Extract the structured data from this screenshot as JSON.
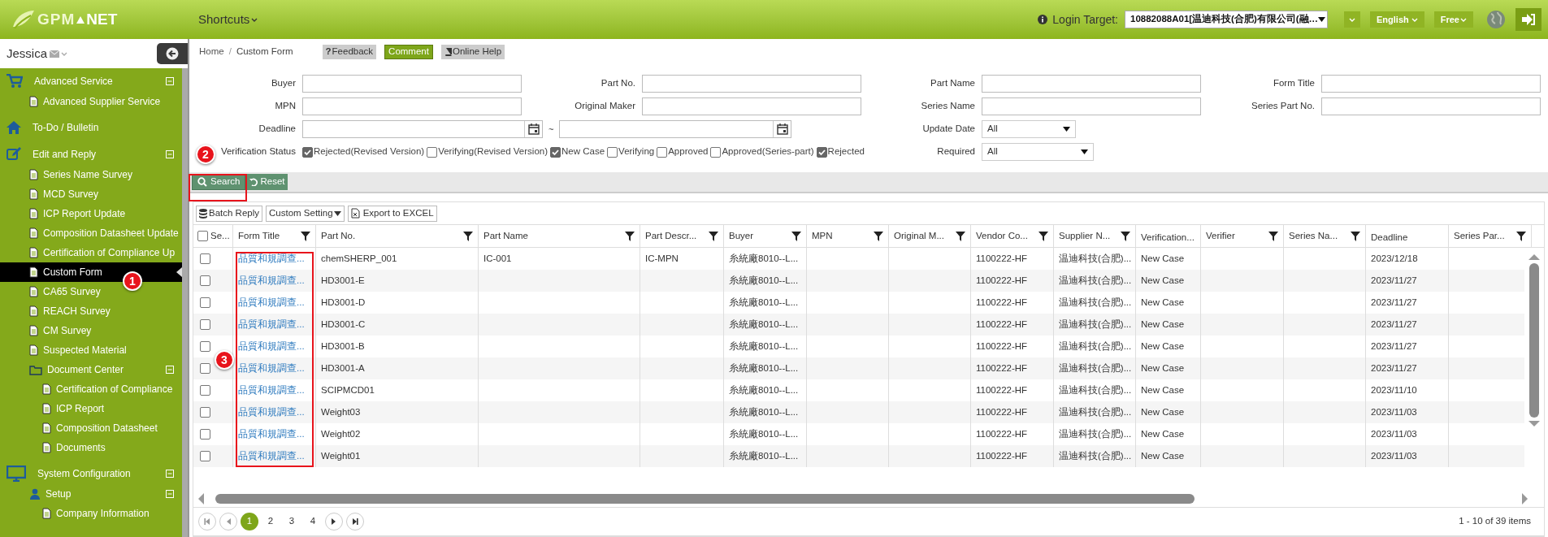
{
  "header": {
    "logo_left": "GPM",
    "logo_right": "NET",
    "shortcuts": "Shortcuts",
    "login_label": "Login Target:",
    "login_value": "10882088A01[温迪科技(合肥)有限公司(融…",
    "language": "English",
    "plan": "Free"
  },
  "sidebar": {
    "user": "Jessica",
    "items": [
      {
        "label": "Advanced Service",
        "kind": "cart",
        "expanded": true,
        "selected": false,
        "children": [
          {
            "label": "Advanced Supplier Service",
            "kind": "doc",
            "selected": false
          }
        ]
      },
      {
        "label": "To-Do / Bulletin",
        "kind": "home",
        "selected": false
      },
      {
        "label": "Edit and Reply",
        "kind": "edit",
        "expanded": true,
        "selected": false,
        "children": [
          {
            "label": "Series Name Survey",
            "kind": "doc",
            "selected": false
          },
          {
            "label": "MCD Survey",
            "kind": "doc",
            "selected": false
          },
          {
            "label": "ICP Report Update",
            "kind": "doc",
            "selected": false
          },
          {
            "label": "Composition Datasheet Update",
            "kind": "doc",
            "selected": false
          },
          {
            "label": "Certification of Compliance Up",
            "kind": "doc",
            "selected": false
          },
          {
            "label": "Custom Form",
            "kind": "doc",
            "selected": true
          },
          {
            "label": "CA65 Survey",
            "kind": "doc",
            "selected": false
          },
          {
            "label": "REACH Survey",
            "kind": "doc",
            "selected": false
          },
          {
            "label": "CM Survey",
            "kind": "doc",
            "selected": false
          },
          {
            "label": "Suspected Material",
            "kind": "doc",
            "selected": false
          },
          {
            "label": "Document Center",
            "kind": "folder",
            "expanded": true,
            "selected": false,
            "children": [
              {
                "label": "Certification of Compliance",
                "kind": "doc",
                "selected": false
              },
              {
                "label": "ICP Report",
                "kind": "doc",
                "selected": false
              },
              {
                "label": "Composition Datasheet",
                "kind": "doc",
                "selected": false
              },
              {
                "label": "Documents",
                "kind": "doc",
                "selected": false
              }
            ]
          }
        ]
      },
      {
        "label": "System Configuration",
        "kind": "monitor",
        "expanded": true,
        "selected": false,
        "children": [
          {
            "label": "Setup",
            "kind": "user",
            "expanded": true,
            "selected": false,
            "children": [
              {
                "label": "Company Information",
                "kind": "doc",
                "selected": false
              }
            ]
          }
        ]
      }
    ]
  },
  "breadcrumb": {
    "items": [
      "Home",
      "Custom Form"
    ],
    "separator": "/"
  },
  "top_buttons": [
    {
      "label": "Feedback",
      "mark": "?",
      "kind": "feedback"
    },
    {
      "label": "Comment",
      "kind": "comment"
    },
    {
      "label": "Online Help",
      "kind": "help"
    }
  ],
  "filters": {
    "buyer": "Buyer",
    "part_no": "Part No.",
    "part_name": "Part Name",
    "form_title": "Form Title",
    "mpn": "MPN",
    "original_maker": "Original Maker",
    "series_name": "Series Name",
    "series_part_no": "Series Part No.",
    "deadline": "Deadline",
    "range_sep": "~",
    "update_date": {
      "label": "Update Date",
      "value": "All"
    },
    "verification_label": "Verification Status",
    "verification": [
      {
        "label": "Rejected(Revised Version)",
        "checked": true
      },
      {
        "label": "Verifying(Revised Version)",
        "checked": false
      },
      {
        "label": "New Case",
        "checked": true
      },
      {
        "label": "Verifying",
        "checked": false
      },
      {
        "label": "Approved",
        "checked": false
      },
      {
        "label": "Approved(Series-part)",
        "checked": false
      },
      {
        "label": "Rejected",
        "checked": true
      }
    ],
    "required": {
      "label": "Required",
      "value": "All"
    }
  },
  "actions": {
    "search": "Search",
    "reset": "Reset"
  },
  "table_toolbar": {
    "batch_reply": "Batch Reply",
    "custom_setting": "Custom Setting",
    "export": "Export to EXCEL"
  },
  "table": {
    "select_all": {
      "label": "Se...",
      "checked": false
    },
    "columns": [
      {
        "label": "Form Title",
        "filter": true
      },
      {
        "label": "Part No.",
        "filter": true
      },
      {
        "label": "Part Name",
        "filter": true
      },
      {
        "label": "Part Descr...",
        "filter": true
      },
      {
        "label": "Buyer",
        "filter": true
      },
      {
        "label": "MPN",
        "filter": true
      },
      {
        "label": "Original M...",
        "filter": true
      },
      {
        "label": "Vendor Co...",
        "filter": true
      },
      {
        "label": "Supplier N...",
        "filter": true
      },
      {
        "label": "Verification...",
        "filter": false
      },
      {
        "label": "Verifier",
        "filter": true
      },
      {
        "label": "Series Na...",
        "filter": true
      },
      {
        "label": "Deadline",
        "filter": false
      },
      {
        "label": "Series Par...",
        "filter": true
      }
    ],
    "rows": [
      {
        "checked": false,
        "title": "品質和規調查...",
        "part_no": "chemSHERP_001",
        "part_name": "IC-001",
        "part_desc": "IC-MPN",
        "buyer": "糸統廠8010--L...",
        "vendor": "1100222-HF",
        "supplier": "温迪科技(合肥)...",
        "verification": "New Case",
        "deadline": "2023/12/18"
      },
      {
        "checked": false,
        "title": "品質和規調查...",
        "part_no": "HD3001-E",
        "buyer": "糸統廠8010--L...",
        "vendor": "1100222-HF",
        "supplier": "温迪科技(合肥)...",
        "verification": "New Case",
        "deadline": "2023/11/27"
      },
      {
        "checked": false,
        "title": "品質和規調查...",
        "part_no": "HD3001-D",
        "buyer": "糸統廠8010--L...",
        "vendor": "1100222-HF",
        "supplier": "温迪科技(合肥)...",
        "verification": "New Case",
        "deadline": "2023/11/27"
      },
      {
        "checked": false,
        "title": "品質和規調查...",
        "part_no": "HD3001-C",
        "buyer": "糸統廠8010--L...",
        "vendor": "1100222-HF",
        "supplier": "温迪科技(合肥)...",
        "verification": "New Case",
        "deadline": "2023/11/27"
      },
      {
        "checked": false,
        "title": "品質和規調查...",
        "part_no": "HD3001-B",
        "buyer": "糸統廠8010--L...",
        "vendor": "1100222-HF",
        "supplier": "温迪科技(合肥)...",
        "verification": "New Case",
        "deadline": "2023/11/27"
      },
      {
        "checked": false,
        "title": "品質和規調查...",
        "part_no": "HD3001-A",
        "buyer": "糸統廠8010--L...",
        "vendor": "1100222-HF",
        "supplier": "温迪科技(合肥)...",
        "verification": "New Case",
        "deadline": "2023/11/27"
      },
      {
        "checked": false,
        "title": "品質和規調查...",
        "part_no": "SCIPMCD01",
        "buyer": "糸統廠8010--L...",
        "vendor": "1100222-HF",
        "supplier": "温迪科技(合肥)...",
        "verification": "New Case",
        "deadline": "2023/11/10"
      },
      {
        "checked": false,
        "title": "品質和規調查...",
        "part_no": "Weight03",
        "buyer": "糸統廠8010--L...",
        "vendor": "1100222-HF",
        "supplier": "温迪科技(合肥)...",
        "verification": "New Case",
        "deadline": "2023/11/03"
      },
      {
        "checked": false,
        "title": "品質和規調查...",
        "part_no": "Weight02",
        "buyer": "糸統廠8010--L...",
        "vendor": "1100222-HF",
        "supplier": "温迪科技(合肥)...",
        "verification": "New Case",
        "deadline": "2023/11/03"
      },
      {
        "checked": false,
        "title": "品質和規調查...",
        "part_no": "Weight01",
        "buyer": "糸統廠8010--L...",
        "vendor": "1100222-HF",
        "supplier": "温迪科技(合肥)...",
        "verification": "New Case",
        "deadline": "2023/11/03"
      }
    ]
  },
  "pager": {
    "pages": [
      {
        "label": "1",
        "selected": true
      },
      {
        "label": "2",
        "selected": false
      },
      {
        "label": "3",
        "selected": false
      },
      {
        "label": "4",
        "selected": false
      }
    ],
    "summary": "1 - 10 of 39 items"
  },
  "annotations": {
    "markers": [
      "1",
      "2",
      "3"
    ],
    "frames": [
      {
        "kind": "frame"
      },
      {
        "kind": "frame"
      }
    ]
  }
}
